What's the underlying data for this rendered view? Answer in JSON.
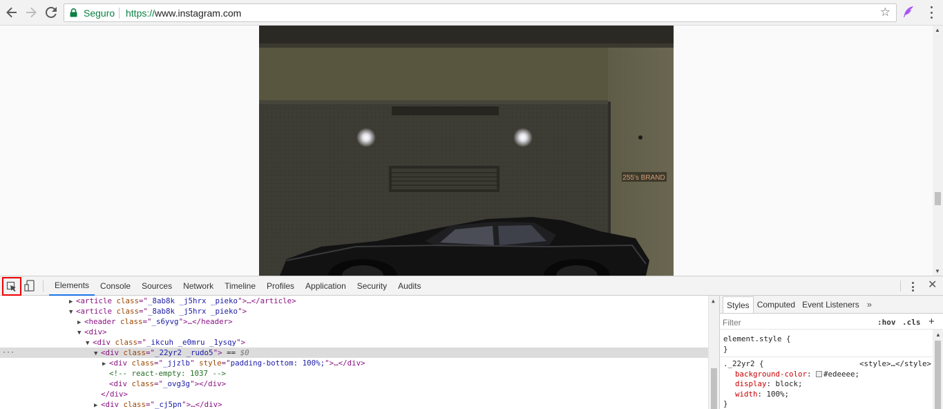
{
  "browser": {
    "secure_label": "Seguro",
    "url_scheme": "https://",
    "url_host": "www.instagram.com"
  },
  "photo": {
    "wall_sign": "255's BRAND"
  },
  "devtools": {
    "tabs": [
      "Elements",
      "Console",
      "Sources",
      "Network",
      "Timeline",
      "Profiles",
      "Application",
      "Security",
      "Audits"
    ],
    "active_tab": "Elements",
    "accent_color": "#1a73e8",
    "highlight_color": "#e00000"
  },
  "tree": {
    "row0": {
      "tag_open": "<article ",
      "attr": "class",
      "value": "_8ab8k _j5hrx _pieko",
      "tail": "…</article>"
    },
    "row1": {
      "tag_open": "<article ",
      "attr": "class",
      "value": "_8ab8k _j5hrx _pieko"
    },
    "row2": {
      "tag_open": "<header ",
      "attr": "class",
      "value": "_s6yvg",
      "tail": "…</header>"
    },
    "row3": {
      "tag_open": "<div>"
    },
    "row4": {
      "tag_open": "<div ",
      "attr": "class",
      "value": "_ikcuh _e0mru _1ysqy"
    },
    "row5": {
      "tag_open": "<div ",
      "attr": "class",
      "value": "_22yr2 _rudo5",
      "equals": " == ",
      "dollar": "$0"
    },
    "row6": {
      "tag_open": "<div ",
      "attr": "class",
      "value": "_jjzlb",
      "attr2": "style",
      "value2": "padding-bottom: 100%;",
      "tail": "…</div>"
    },
    "row7": {
      "comment": "<!-- react-empty: 1037 -->"
    },
    "row8": {
      "tag_open": "<div ",
      "attr": "class",
      "value": "_ovg3g",
      "tail": "</div>"
    },
    "row9": {
      "tag_close": "</div>"
    },
    "row10": {
      "tag_open": "<div ",
      "attr": "class",
      "value": "_cj5pn",
      "tail": "…</div>"
    }
  },
  "styles": {
    "tabs": [
      "Styles",
      "Computed",
      "Event Listeners"
    ],
    "filter_placeholder": "Filter",
    "hov": ":hov",
    "cls": ".cls",
    "element_style_selector": "element.style {",
    "element_style_close": "}",
    "rule_selector": "._22yr2 {",
    "rule_source": "<style>…</style>",
    "prop1_name": "background-color",
    "prop1_value": "#edeeee;",
    "prop1_swatch": "#edeeee",
    "prop2_name": "display",
    "prop2_value": "block;",
    "prop3_name": "width",
    "prop3_value": "100%;",
    "rule_close": "}"
  }
}
